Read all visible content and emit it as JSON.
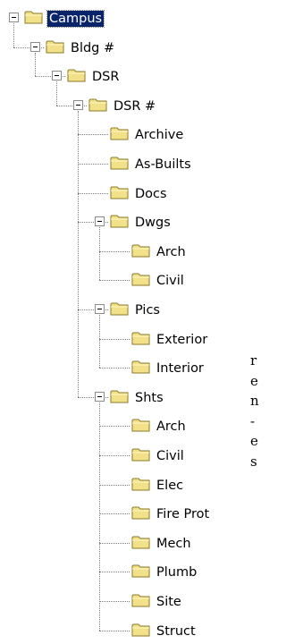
{
  "tree": [
    {
      "label": "Campus",
      "depth": 0,
      "expanded": true,
      "selected": true
    },
    {
      "label": "Bldg #",
      "depth": 1,
      "expanded": true
    },
    {
      "label": "DSR",
      "depth": 2,
      "expanded": true
    },
    {
      "label": "DSR #",
      "depth": 3,
      "expanded": true
    },
    {
      "label": "Archive",
      "depth": 4
    },
    {
      "label": "As-Builts",
      "depth": 4
    },
    {
      "label": "Docs",
      "depth": 4
    },
    {
      "label": "Dwgs",
      "depth": 4,
      "expanded": true
    },
    {
      "label": "Arch",
      "depth": 5
    },
    {
      "label": "Civil",
      "depth": 5
    },
    {
      "label": "Pics",
      "depth": 4,
      "expanded": true
    },
    {
      "label": "Exterior",
      "depth": 5
    },
    {
      "label": "Interior",
      "depth": 5
    },
    {
      "label": "Shts",
      "depth": 4,
      "expanded": true
    },
    {
      "label": "Arch",
      "depth": 5
    },
    {
      "label": "Civil",
      "depth": 5
    },
    {
      "label": "Elec",
      "depth": 5
    },
    {
      "label": "Fire Prot",
      "depth": 5
    },
    {
      "label": "Mech",
      "depth": 5
    },
    {
      "label": "Plumb",
      "depth": 5
    },
    {
      "label": "Site",
      "depth": 5
    },
    {
      "label": "Struct",
      "depth": 5
    }
  ],
  "side_text": [
    "r",
    "e",
    "n",
    "-",
    "e",
    "s"
  ],
  "colors": {
    "folder_fill": "#f2e189",
    "folder_stroke": "#8a7a2a",
    "selection": "#0a246a"
  },
  "icons": {
    "folder": "folder-icon",
    "expander": "collapse-icon"
  }
}
